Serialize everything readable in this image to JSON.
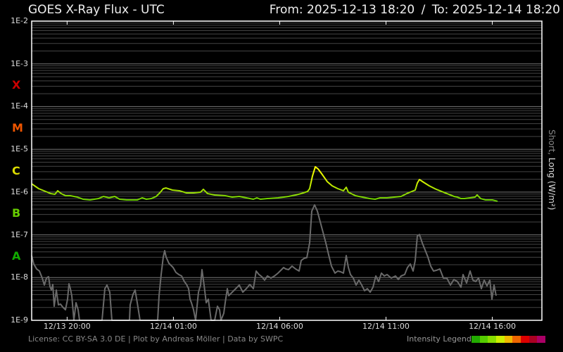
{
  "header": {
    "title": "GOES X-Ray Flux - UTC",
    "from": "From: 2025-12-13 18:20",
    "separator": "/",
    "to": "To: 2025-12-14 18:20"
  },
  "footer": {
    "credits": "License: CC BY-SA 3.0 DE | Plot by Andreas Möller | Data by SWPC",
    "legend_label": "Intensity Legend",
    "legend_colors": [
      "#22aa00",
      "#55cc00",
      "#88dd00",
      "#ccee00",
      "#f0b800",
      "#ee6600",
      "#dd0000",
      "#aa0022",
      "#aa0066"
    ]
  },
  "chart_data": {
    "type": "line",
    "title": "GOES X-Ray Flux - UTC",
    "ylabel_short": "Short,",
    "ylabel_long": "Long (W/m²)",
    "yscale": "log",
    "ylim_exp": [
      -9,
      -2
    ],
    "ytick_labels": [
      "1E-2",
      "1E-3",
      "1E-4",
      "1E-5",
      "1E-6",
      "1E-7",
      "1E-8",
      "1E-9"
    ],
    "flare_classes": [
      {
        "label": "X",
        "exp": -3.5,
        "color": "#cc0000"
      },
      {
        "label": "M",
        "exp": -4.5,
        "color": "#ee5500"
      },
      {
        "label": "C",
        "exp": -5.5,
        "color": "#dddd00"
      },
      {
        "label": "B",
        "exp": -6.5,
        "color": "#66cc00"
      },
      {
        "label": "A",
        "exp": -7.5,
        "color": "#11aa00"
      }
    ],
    "x_unit": "hours since 2025-12-13 18:20 UTC",
    "xlim": [
      0,
      24
    ],
    "xticks": [
      {
        "h": 1.667,
        "label": "12/13 20:00"
      },
      {
        "h": 6.667,
        "label": "12/14 01:00"
      },
      {
        "h": 11.667,
        "label": "12/14 06:00"
      },
      {
        "h": 16.667,
        "label": "12/14 11:00"
      },
      {
        "h": 21.667,
        "label": "12/14 16:00"
      }
    ],
    "series": [
      {
        "name": "Long",
        "points_px_note": "[hour, log10 flux]",
        "points": []
      },
      {
        "name": "Short",
        "color": "#6a6a6a",
        "points": []
      }
    ],
    "long_raw": [
      [
        45,
        261
      ],
      [
        55,
        268
      ],
      [
        65,
        272
      ],
      [
        72,
        275
      ],
      [
        78,
        276
      ],
      [
        82,
        271
      ],
      [
        87,
        275
      ],
      [
        93,
        278
      ],
      [
        100,
        278
      ],
      [
        110,
        280
      ],
      [
        118,
        283
      ],
      [
        128,
        284
      ],
      [
        140,
        282
      ],
      [
        147,
        279
      ],
      [
        155,
        281
      ],
      [
        163,
        279
      ],
      [
        170,
        283
      ],
      [
        180,
        284
      ],
      [
        195,
        284
      ],
      [
        202,
        281
      ],
      [
        208,
        283
      ],
      [
        215,
        282
      ],
      [
        222,
        279
      ],
      [
        227,
        274
      ],
      [
        232,
        268
      ],
      [
        236,
        267
      ],
      [
        245,
        270
      ],
      [
        255,
        271
      ],
      [
        265,
        274
      ],
      [
        275,
        274
      ],
      [
        285,
        273
      ],
      [
        289,
        269
      ],
      [
        295,
        275
      ],
      [
        305,
        277
      ],
      [
        320,
        278
      ],
      [
        330,
        280
      ],
      [
        340,
        279
      ],
      [
        350,
        281
      ],
      [
        360,
        283
      ],
      [
        365,
        281
      ],
      [
        370,
        283
      ],
      [
        380,
        282
      ],
      [
        395,
        281
      ],
      [
        403,
        280
      ],
      [
        410,
        279
      ],
      [
        420,
        277
      ],
      [
        428,
        275
      ],
      [
        437,
        272
      ],
      [
        440,
        268
      ],
      [
        444,
        250
      ],
      [
        448,
        237
      ],
      [
        452,
        240
      ],
      [
        458,
        248
      ],
      [
        465,
        258
      ],
      [
        472,
        264
      ],
      [
        480,
        268
      ],
      [
        488,
        271
      ],
      [
        492,
        266
      ],
      [
        495,
        273
      ],
      [
        505,
        278
      ],
      [
        515,
        280
      ],
      [
        525,
        282
      ],
      [
        533,
        283
      ],
      [
        540,
        281
      ],
      [
        550,
        281
      ],
      [
        560,
        280
      ],
      [
        570,
        279
      ],
      [
        578,
        275
      ],
      [
        585,
        272
      ],
      [
        590,
        270
      ],
      [
        593,
        260
      ],
      [
        596,
        255
      ],
      [
        602,
        259
      ],
      [
        610,
        264
      ],
      [
        620,
        269
      ],
      [
        630,
        273
      ],
      [
        640,
        277
      ],
      [
        645,
        279
      ],
      [
        650,
        280
      ],
      [
        655,
        282
      ],
      [
        660,
        282
      ],
      [
        668,
        281
      ],
      [
        675,
        280
      ],
      [
        678,
        277
      ],
      [
        683,
        282
      ],
      [
        690,
        284
      ],
      [
        700,
        284
      ],
      [
        707,
        286
      ]
    ],
    "short_raw": [
      [
        45,
        363
      ],
      [
        48,
        375
      ],
      [
        52,
        382
      ],
      [
        56,
        385
      ],
      [
        60,
        395
      ],
      [
        63,
        405
      ],
      [
        66,
        395
      ],
      [
        69,
        393
      ],
      [
        71,
        407
      ],
      [
        73,
        412
      ],
      [
        75,
        404
      ],
      [
        77,
        435
      ],
      [
        80,
        412
      ],
      [
        83,
        433
      ],
      [
        86,
        432
      ],
      [
        89,
        436
      ],
      [
        93,
        440
      ],
      [
        96,
        425
      ],
      [
        98,
        403
      ],
      [
        100,
        410
      ],
      [
        102,
        420
      ],
      [
        105,
        455
      ],
      [
        108,
        430
      ],
      [
        111,
        440
      ],
      [
        113,
        455
      ],
      [
        145,
        455
      ],
      [
        149,
        410
      ],
      [
        152,
        405
      ],
      [
        156,
        415
      ],
      [
        159,
        455
      ],
      [
        184,
        455
      ],
      [
        185,
        433
      ],
      [
        189,
        418
      ],
      [
        192,
        412
      ],
      [
        195,
        430
      ],
      [
        199,
        455
      ],
      [
        224,
        455
      ],
      [
        226,
        420
      ],
      [
        229,
        390
      ],
      [
        232,
        365
      ],
      [
        234,
        356
      ],
      [
        236,
        365
      ],
      [
        240,
        374
      ],
      [
        246,
        380
      ],
      [
        250,
        387
      ],
      [
        254,
        390
      ],
      [
        258,
        392
      ],
      [
        262,
        400
      ],
      [
        265,
        404
      ],
      [
        268,
        410
      ],
      [
        270,
        425
      ],
      [
        272,
        430
      ],
      [
        275,
        440
      ],
      [
        278,
        455
      ],
      [
        282,
        415
      ],
      [
        285,
        405
      ],
      [
        287,
        383
      ],
      [
        290,
        405
      ],
      [
        293,
        430
      ],
      [
        296,
        425
      ],
      [
        300,
        455
      ],
      [
        305,
        455
      ],
      [
        309,
        435
      ],
      [
        312,
        440
      ],
      [
        314,
        455
      ],
      [
        318,
        445
      ],
      [
        320,
        430
      ],
      [
        323,
        410
      ],
      [
        325,
        420
      ],
      [
        330,
        415
      ],
      [
        335,
        410
      ],
      [
        340,
        405
      ],
      [
        345,
        415
      ],
      [
        350,
        410
      ],
      [
        355,
        404
      ],
      [
        360,
        410
      ],
      [
        364,
        385
      ],
      [
        368,
        390
      ],
      [
        372,
        393
      ],
      [
        376,
        398
      ],
      [
        380,
        392
      ],
      [
        385,
        395
      ],
      [
        390,
        392
      ],
      [
        395,
        388
      ],
      [
        398,
        385
      ],
      [
        403,
        380
      ],
      [
        406,
        382
      ],
      [
        410,
        383
      ],
      [
        415,
        378
      ],
      [
        420,
        382
      ],
      [
        425,
        385
      ],
      [
        428,
        370
      ],
      [
        432,
        367
      ],
      [
        436,
        366
      ],
      [
        440,
        345
      ],
      [
        443,
        300
      ],
      [
        447,
        291
      ],
      [
        451,
        300
      ],
      [
        455,
        315
      ],
      [
        459,
        330
      ],
      [
        463,
        345
      ],
      [
        467,
        362
      ],
      [
        471,
        378
      ],
      [
        476,
        388
      ],
      [
        480,
        385
      ],
      [
        484,
        386
      ],
      [
        488,
        388
      ],
      [
        492,
        363
      ],
      [
        495,
        380
      ],
      [
        498,
        390
      ],
      [
        502,
        395
      ],
      [
        506,
        405
      ],
      [
        510,
        398
      ],
      [
        514,
        405
      ],
      [
        518,
        413
      ],
      [
        522,
        410
      ],
      [
        526,
        415
      ],
      [
        530,
        408
      ],
      [
        534,
        392
      ],
      [
        538,
        400
      ],
      [
        542,
        388
      ],
      [
        546,
        392
      ],
      [
        550,
        390
      ],
      [
        556,
        395
      ],
      [
        562,
        392
      ],
      [
        566,
        397
      ],
      [
        570,
        392
      ],
      [
        575,
        390
      ],
      [
        579,
        380
      ],
      [
        583,
        375
      ],
      [
        587,
        385
      ],
      [
        590,
        370
      ],
      [
        593,
        335
      ],
      [
        596,
        333
      ],
      [
        600,
        345
      ],
      [
        604,
        355
      ],
      [
        608,
        365
      ],
      [
        612,
        378
      ],
      [
        616,
        385
      ],
      [
        620,
        384
      ],
      [
        625,
        382
      ],
      [
        630,
        395
      ],
      [
        635,
        395
      ],
      [
        640,
        405
      ],
      [
        645,
        397
      ],
      [
        650,
        400
      ],
      [
        655,
        408
      ],
      [
        658,
        390
      ],
      [
        663,
        402
      ],
      [
        668,
        385
      ],
      [
        672,
        398
      ],
      [
        676,
        400
      ],
      [
        680,
        395
      ],
      [
        684,
        410
      ],
      [
        688,
        398
      ],
      [
        692,
        406
      ],
      [
        696,
        398
      ],
      [
        699,
        425
      ],
      [
        702,
        405
      ],
      [
        705,
        420
      ]
    ]
  }
}
